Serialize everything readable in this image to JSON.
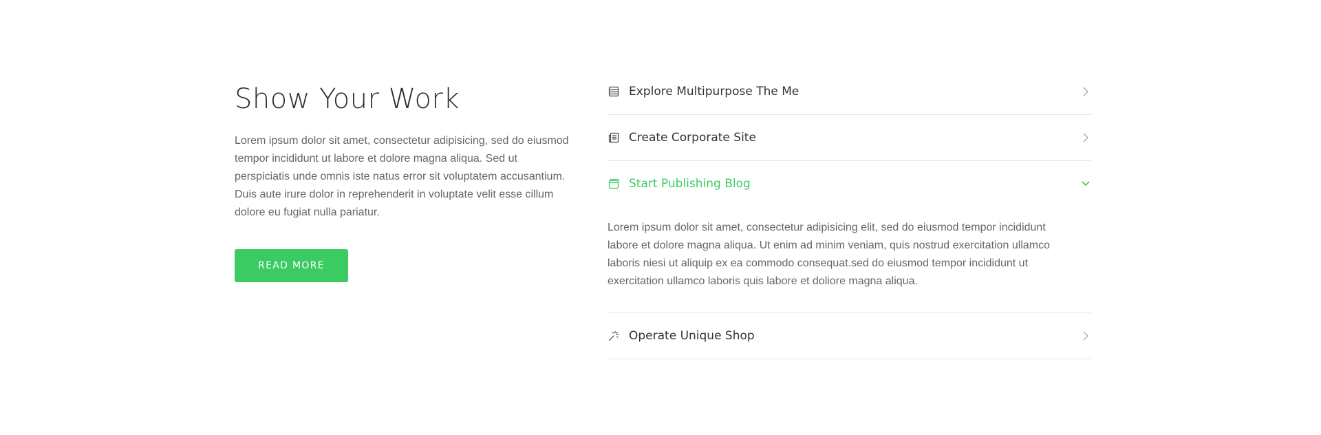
{
  "section": {
    "title": "Show Your Work",
    "paragraphs": [
      "Lorem ipsum dolor sit amet, consectetur adipisicing, sed do eiusmod tempor incididunt ut labore et dolore magna aliqua. Sed ut perspiciatis unde omnis iste natus error sit voluptatem accusantium.",
      "Duis aute irure dolor in reprehenderit in voluptate velit esse cillum dolore eu fugiat nulla pariatur."
    ],
    "button_label": "READ MORE"
  },
  "accordion": {
    "items": [
      {
        "label": "Explore Multipurpose The Me",
        "icon": "server-icon",
        "state": "collapsed"
      },
      {
        "label": "Create Corporate Site",
        "icon": "newspaper-icon",
        "state": "collapsed"
      },
      {
        "label": "Start Publishing Blog",
        "icon": "window-icon",
        "state": "expanded",
        "content_lines": [
          "Lorem ipsum dolor sit amet, consectetur adipisicing elit, sed do eiusmod tempor incididunt",
          "labore et dolore magna aliqua. Ut enim ad minim veniam, quis nostrud exercitation ullamco",
          "laboris niesi ut aliquip ex ea commodo consequat.sed do eiusmod tempor incididunt ut",
          "exercitation ullamco laboris quis  labore et doliore magna aliqua."
        ]
      },
      {
        "label": "Operate Unique Shop",
        "icon": "magic-wand-icon",
        "state": "collapsed"
      }
    ]
  },
  "colors": {
    "accent": "#3bcb62",
    "heading": "#2f2f2f",
    "body_text": "#666666",
    "divider": "#e4e4e4",
    "chevron": "#b0b0b0"
  }
}
